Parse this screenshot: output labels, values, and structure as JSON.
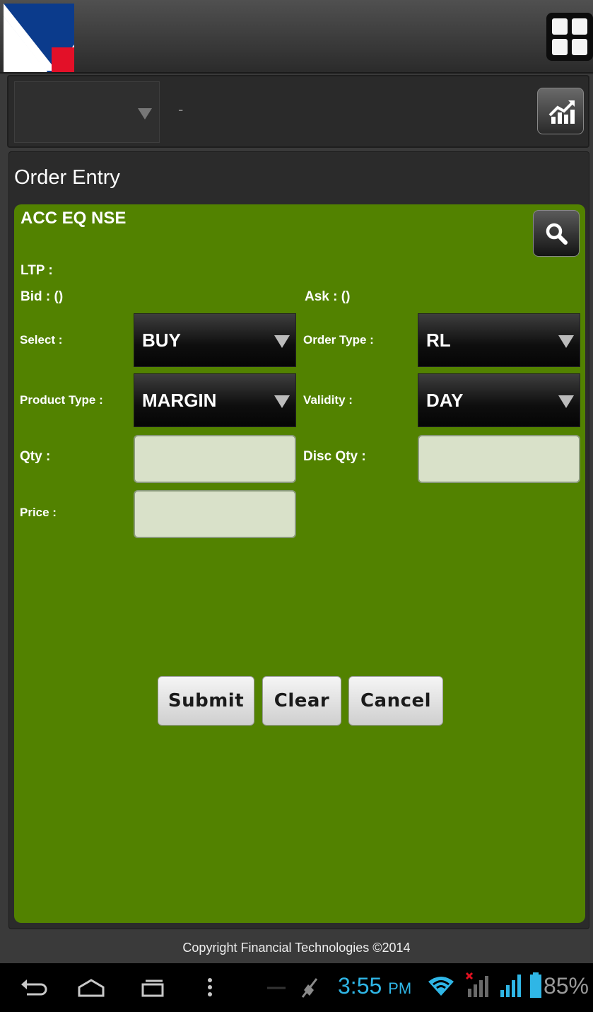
{
  "header": {
    "logo_icon": "logo-icon",
    "menu_icon": "grid-menu-icon"
  },
  "symbol_bar": {
    "selected_value": "",
    "separator": "-",
    "chart_icon": "chart-icon"
  },
  "panel": {
    "title": "Order Entry"
  },
  "form": {
    "scrip": "ACC EQ NSE",
    "ltp_label": "LTP :",
    "bid_label": "Bid : ()",
    "ask_label": "Ask : ()",
    "select_label": "Select :",
    "select_value": "BUY",
    "order_type_label": "Order Type :",
    "order_type_value": "RL",
    "product_type_label": "Product Type :",
    "product_type_value": "MARGIN",
    "validity_label": "Validity :",
    "validity_value": "DAY",
    "qty_label": "Qty :",
    "qty_value": "",
    "disc_qty_label": "Disc Qty :",
    "disc_qty_value": "",
    "price_label": "Price :",
    "price_value": "",
    "submit_label": "Submit",
    "clear_label": "Clear",
    "cancel_label": "Cancel"
  },
  "footer": {
    "copyright": "Copyright Financial Technologies ©2014"
  },
  "status_bar": {
    "time": "3:55",
    "ampm": "PM",
    "battery": "85%"
  },
  "colors": {
    "form_bg": "#528200",
    "accent_clock": "#2fb6e6",
    "logo_blue": "#0a3a8a",
    "logo_red": "#e0102a"
  }
}
